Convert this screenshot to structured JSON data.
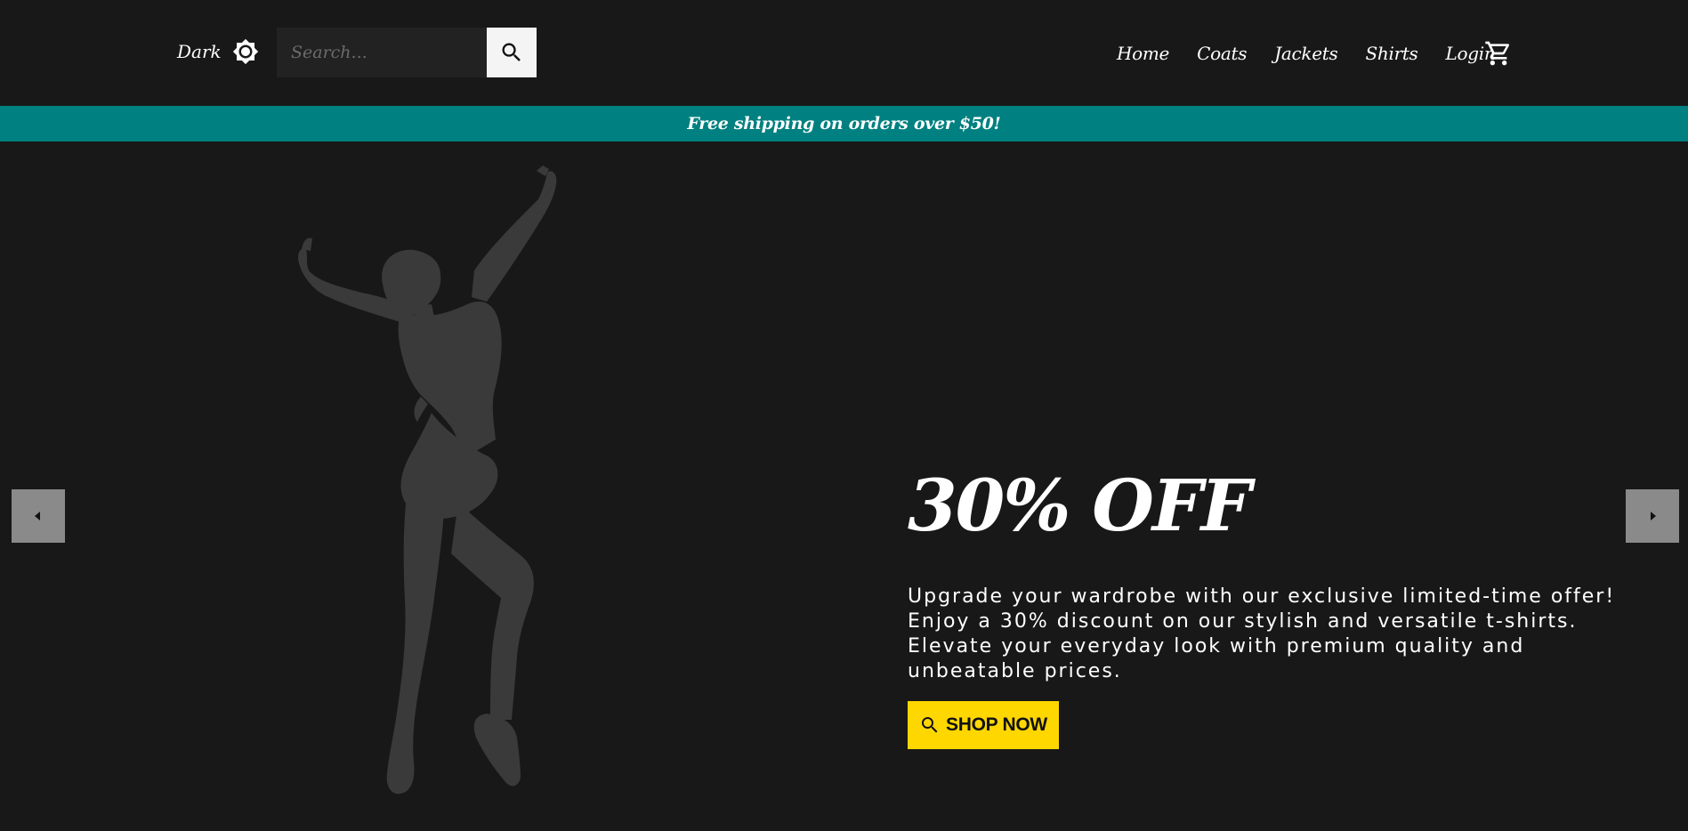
{
  "header": {
    "theme_toggle": {
      "label": "Dark",
      "icon": "brightness-icon"
    },
    "search": {
      "placeholder": "Search...",
      "value": "",
      "button_icon": "search-icon"
    },
    "nav": {
      "items": [
        {
          "label": "Home"
        },
        {
          "label": "Coats"
        },
        {
          "label": "Jackets"
        },
        {
          "label": "Shirts"
        },
        {
          "label": "Login"
        }
      ],
      "cart_icon": "cart-icon"
    }
  },
  "promo_bar": {
    "text": "Free shipping on orders over $50!",
    "background": "#008080"
  },
  "hero": {
    "image": "dancer-silhouette",
    "title": "30% OFF",
    "description": "Upgrade your wardrobe with our exclusive limited-time offer! Enjoy a 30% discount on our stylish and versatile t-shirts. Elevate your everyday look with premium quality and unbeatable prices.",
    "cta": {
      "label": "SHOP NOW",
      "icon": "search-icon",
      "background": "#ffd700"
    },
    "carousel": {
      "prev_icon": "arrow-left-icon",
      "next_icon": "arrow-right-icon"
    }
  },
  "colors": {
    "background": "#181818",
    "accent": "#008080",
    "cta": "#ffd700",
    "silhouette": "#3a3a3a",
    "arrow_bg": "#8a8a8a"
  }
}
